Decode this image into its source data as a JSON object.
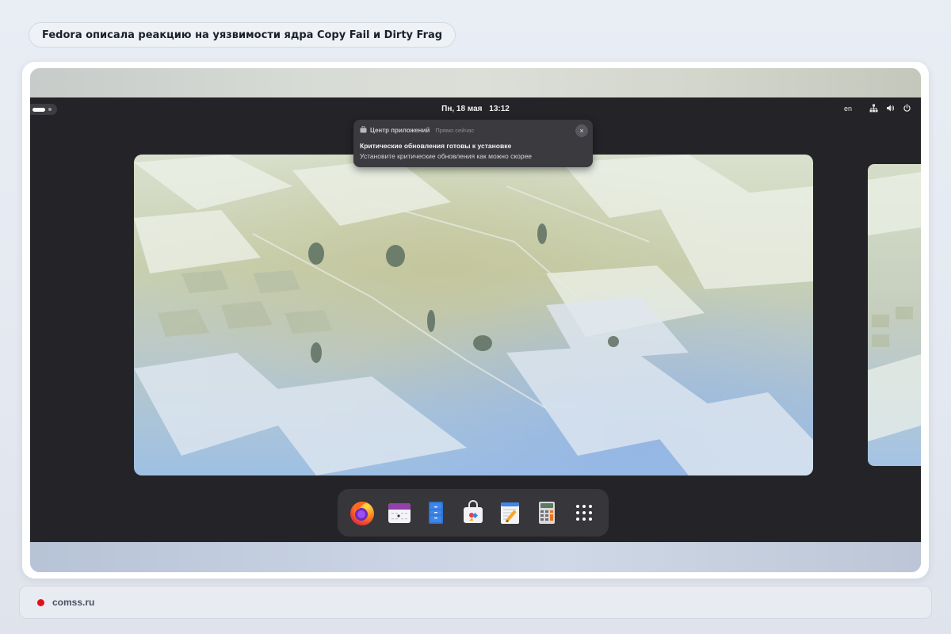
{
  "headline": "Fedora описала реакцию на уязвимости ядра Copy Fail и Dirty Frag",
  "topbar": {
    "day": "Пн, 18 мая",
    "time": "13:12",
    "keyboard_layout": "en",
    "tray_icons": [
      "network-icon",
      "volume-icon",
      "power-icon"
    ]
  },
  "notification": {
    "app_name": "Центр приложений",
    "time": "Прямо сейчас",
    "title": "Критические обновления готовы к установке",
    "body": "Установите критические обновления как можно скорее",
    "close_glyph": "×"
  },
  "dash": {
    "items": [
      {
        "name": "firefox-icon"
      },
      {
        "name": "calendar-icon"
      },
      {
        "name": "file-cabinet-icon"
      },
      {
        "name": "software-center-icon"
      },
      {
        "name": "text-editor-icon"
      },
      {
        "name": "calculator-icon"
      },
      {
        "name": "app-grid-icon"
      }
    ]
  },
  "source": {
    "text": "comss.ru",
    "dot_color": "#e0101a"
  }
}
